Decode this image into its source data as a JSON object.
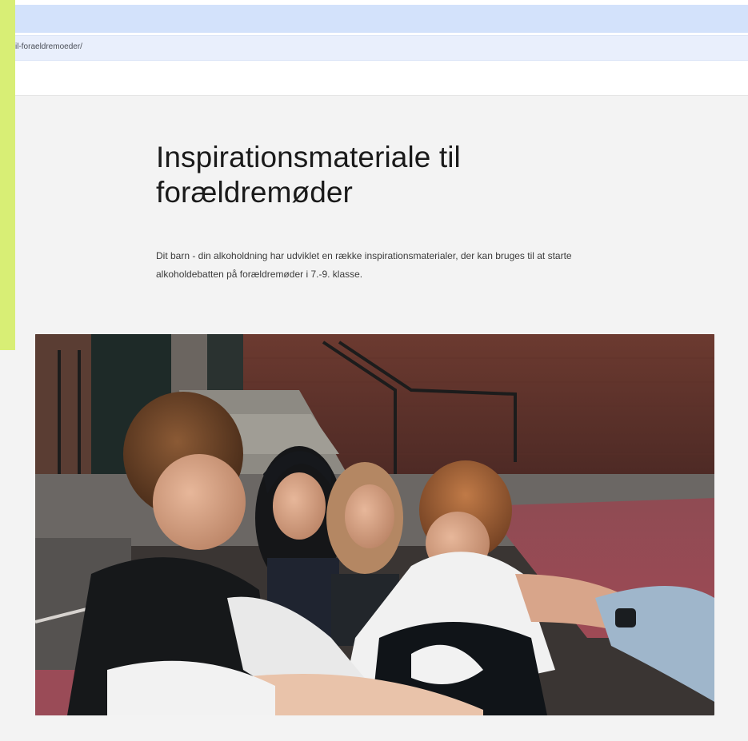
{
  "browser": {
    "url": "il-foraeldremoeder/"
  },
  "page": {
    "title": "Inspirationsmateriale til forældremøder",
    "intro": "Dit barn - din alkoholdning har udviklet en række inspirationsmaterialer, der kan bruges til at starte alkoholdebatten på forældremøder i 7.-9. klasse."
  },
  "colors": {
    "tab_strip": "#d3e2fb",
    "address_bar": "#e9effc",
    "page_background": "#f3f3f3",
    "accent_strip": "#d8ee75"
  }
}
